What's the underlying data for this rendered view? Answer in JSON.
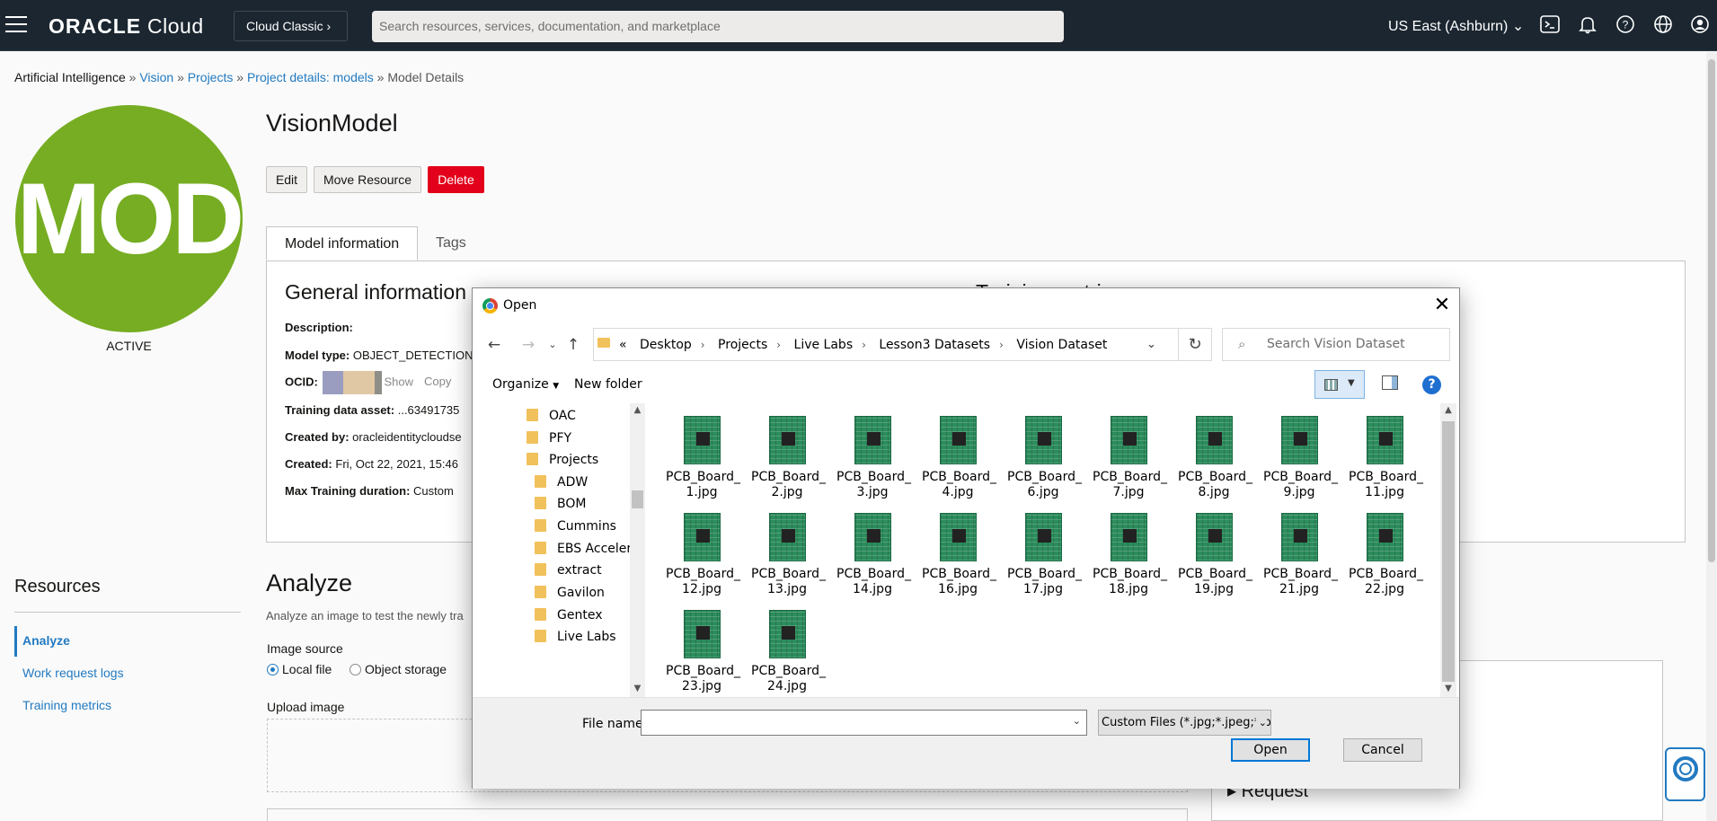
{
  "topbar": {
    "brand_bold": "ORACLE",
    "brand_light": " Cloud",
    "classic_label": "Cloud Classic",
    "search_placeholder": "Search resources, services, documentation, and marketplace",
    "region": "US East (Ashburn)"
  },
  "breadcrumb": {
    "items": [
      "Artificial Intelligence",
      "Vision",
      "Projects",
      "Project details: models",
      "Model Details"
    ],
    "separator": "»"
  },
  "avatar": {
    "text": "MOD",
    "status": "ACTIVE",
    "color": "#76ad22"
  },
  "model": {
    "title": "VisionModel",
    "edit_label": "Edit",
    "move_label": "Move Resource",
    "delete_label": "Delete"
  },
  "tabs": [
    "Model information",
    "Tags"
  ],
  "general_info": {
    "title": "General information",
    "training_title": "Training metrics",
    "description_label": "Description:",
    "model_type_label": "Model type:",
    "model_type_value": "OBJECT_DETECTION",
    "ocid_label": "OCID:",
    "ocid_show": "Show",
    "ocid_copy": "Copy",
    "training_asset_label": "Training data asset:",
    "training_asset_value": "...63491735",
    "created_by_label": "Created by:",
    "created_by_value": "oracleidentitycloudse",
    "created_label": "Created:",
    "created_value": "Fri, Oct 22, 2021, 15:46",
    "max_training_label": "Max Training duration:",
    "max_training_value": "Custom"
  },
  "resources": {
    "title": "Resources",
    "items": [
      "Analyze",
      "Work request logs",
      "Training metrics"
    ]
  },
  "analyze": {
    "title": "Analyze",
    "description": "Analyze an image to test the newly tra",
    "image_source_label": "Image source",
    "option_local": "Local file",
    "option_object": "Object storage",
    "upload_label": "Upload image",
    "request_label": "Request"
  },
  "dialog": {
    "title": "Open",
    "path": [
      "Desktop",
      "Projects",
      "Live Labs",
      "Lesson3 Datasets",
      "Vision Dataset"
    ],
    "path_prefix": "«",
    "search_placeholder": "Search Vision Dataset",
    "organize_label": "Organize",
    "new_folder_label": "New folder",
    "tree": [
      {
        "label": "OAC",
        "level": 1
      },
      {
        "label": "PFY",
        "level": 1
      },
      {
        "label": "Projects",
        "level": 1
      },
      {
        "label": "ADW",
        "level": 2
      },
      {
        "label": "BOM",
        "level": 2
      },
      {
        "label": "Cummins",
        "level": 2
      },
      {
        "label": "EBS Acceler",
        "level": 2
      },
      {
        "label": "extract",
        "level": 2
      },
      {
        "label": "Gavilon",
        "level": 2
      },
      {
        "label": "Gentex",
        "level": 2
      },
      {
        "label": "Live Labs",
        "level": 2
      }
    ],
    "files": [
      [
        "PCB_Board_",
        "1.jpg"
      ],
      [
        "PCB_Board_",
        "2.jpg"
      ],
      [
        "PCB_Board_",
        "3.jpg"
      ],
      [
        "PCB_Board_",
        "4.jpg"
      ],
      [
        "PCB_Board_",
        "6.jpg"
      ],
      [
        "PCB_Board_",
        "7.jpg"
      ],
      [
        "PCB_Board_",
        "8.jpg"
      ],
      [
        "PCB_Board_",
        "9.jpg"
      ],
      [
        "PCB_Board_",
        "11.jpg"
      ],
      [
        "PCB_Board_",
        "12.jpg"
      ],
      [
        "PCB_Board_",
        "13.jpg"
      ],
      [
        "PCB_Board_",
        "14.jpg"
      ],
      [
        "PCB_Board_",
        "16.jpg"
      ],
      [
        "PCB_Board_",
        "17.jpg"
      ],
      [
        "PCB_Board_",
        "18.jpg"
      ],
      [
        "PCB_Board_",
        "19.jpg"
      ],
      [
        "PCB_Board_",
        "21.jpg"
      ],
      [
        "PCB_Board_",
        "22.jpg"
      ],
      [
        "PCB_Board_",
        "23.jpg"
      ],
      [
        "PCB_Board_",
        "24.jpg"
      ]
    ],
    "file_name_label": "File name:",
    "file_name_value": "",
    "filter_value": "Custom Files (*.jpg;*.jpeg;*.png;",
    "open_label": "Open",
    "cancel_label": "Cancel"
  },
  "colors": {
    "accent": "#227ac1",
    "danger": "#e3001b",
    "nav_bg": "#1b2630"
  }
}
